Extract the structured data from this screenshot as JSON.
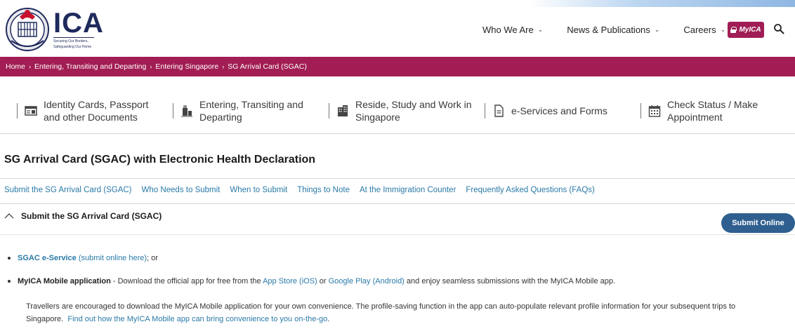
{
  "header": {
    "logo_text": "ICA",
    "logo_tagline_1": "Securing Our Borders,",
    "logo_tagline_2": "Safeguarding Our Home",
    "nav": [
      {
        "label": "Who We Are"
      },
      {
        "label": "News & Publications"
      },
      {
        "label": "Careers"
      }
    ],
    "myica_label": "MyICA"
  },
  "breadcrumb": [
    "Home",
    "Entering, Transiting and Departing",
    "Entering Singapore",
    "SG Arrival Card (SGAC)"
  ],
  "categories": [
    {
      "line1": "Identity Cards, Passport",
      "line2": "and other Documents",
      "icon": "id-card-icon"
    },
    {
      "line1": "Entering, Transiting and",
      "line2": "Departing",
      "icon": "luggage-icon"
    },
    {
      "line1": "Reside, Study and Work in",
      "line2": "Singapore",
      "icon": "building-icon"
    },
    {
      "line1": "e-Services and Forms",
      "line2": "",
      "icon": "document-icon"
    },
    {
      "line1": "Check Status / Make",
      "line2": "Appointment",
      "icon": "calendar-icon"
    }
  ],
  "page_title": "SG Arrival Card (SGAC) with Electronic Health Declaration",
  "anchor_links": [
    "Submit the SG Arrival Card (SGAC)",
    "Who Needs to Submit",
    "When to Submit",
    "Things to Note",
    "At the Immigration Counter",
    "Frequently Asked Questions (FAQs)"
  ],
  "section": {
    "heading": "Submit the SG Arrival Card (SGAC)",
    "submit_button": "Submit Online",
    "item1_link": "SGAC e-Service",
    "item1_sub": "(submit online here)",
    "item1_tail": "; or",
    "item2_bold": "MyICA Mobile application",
    "item2_text_a": " - Download the official app for free from the ",
    "item2_link_a": "App Store (iOS)",
    "item2_text_b": " or ",
    "item2_link_b": "Google Play (Android)",
    "item2_text_c": " and enjoy seamless submissions with the MyICA Mobile app.",
    "para_text": "Travellers are encouraged to download the MyICA Mobile application for your own convenience. The profile-saving function in the app can auto-populate relevant profile information for your subsequent trips to Singapore.",
    "para_link": "Find out how the MyICA Mobile app can bring convenience to you on-the-go",
    "para_tail": "."
  },
  "colors": {
    "brand_maroon": "#a21d53",
    "link_blue": "#2a7aa8",
    "button_blue": "#2f5f8f",
    "logo_navy": "#1f2a5c"
  }
}
